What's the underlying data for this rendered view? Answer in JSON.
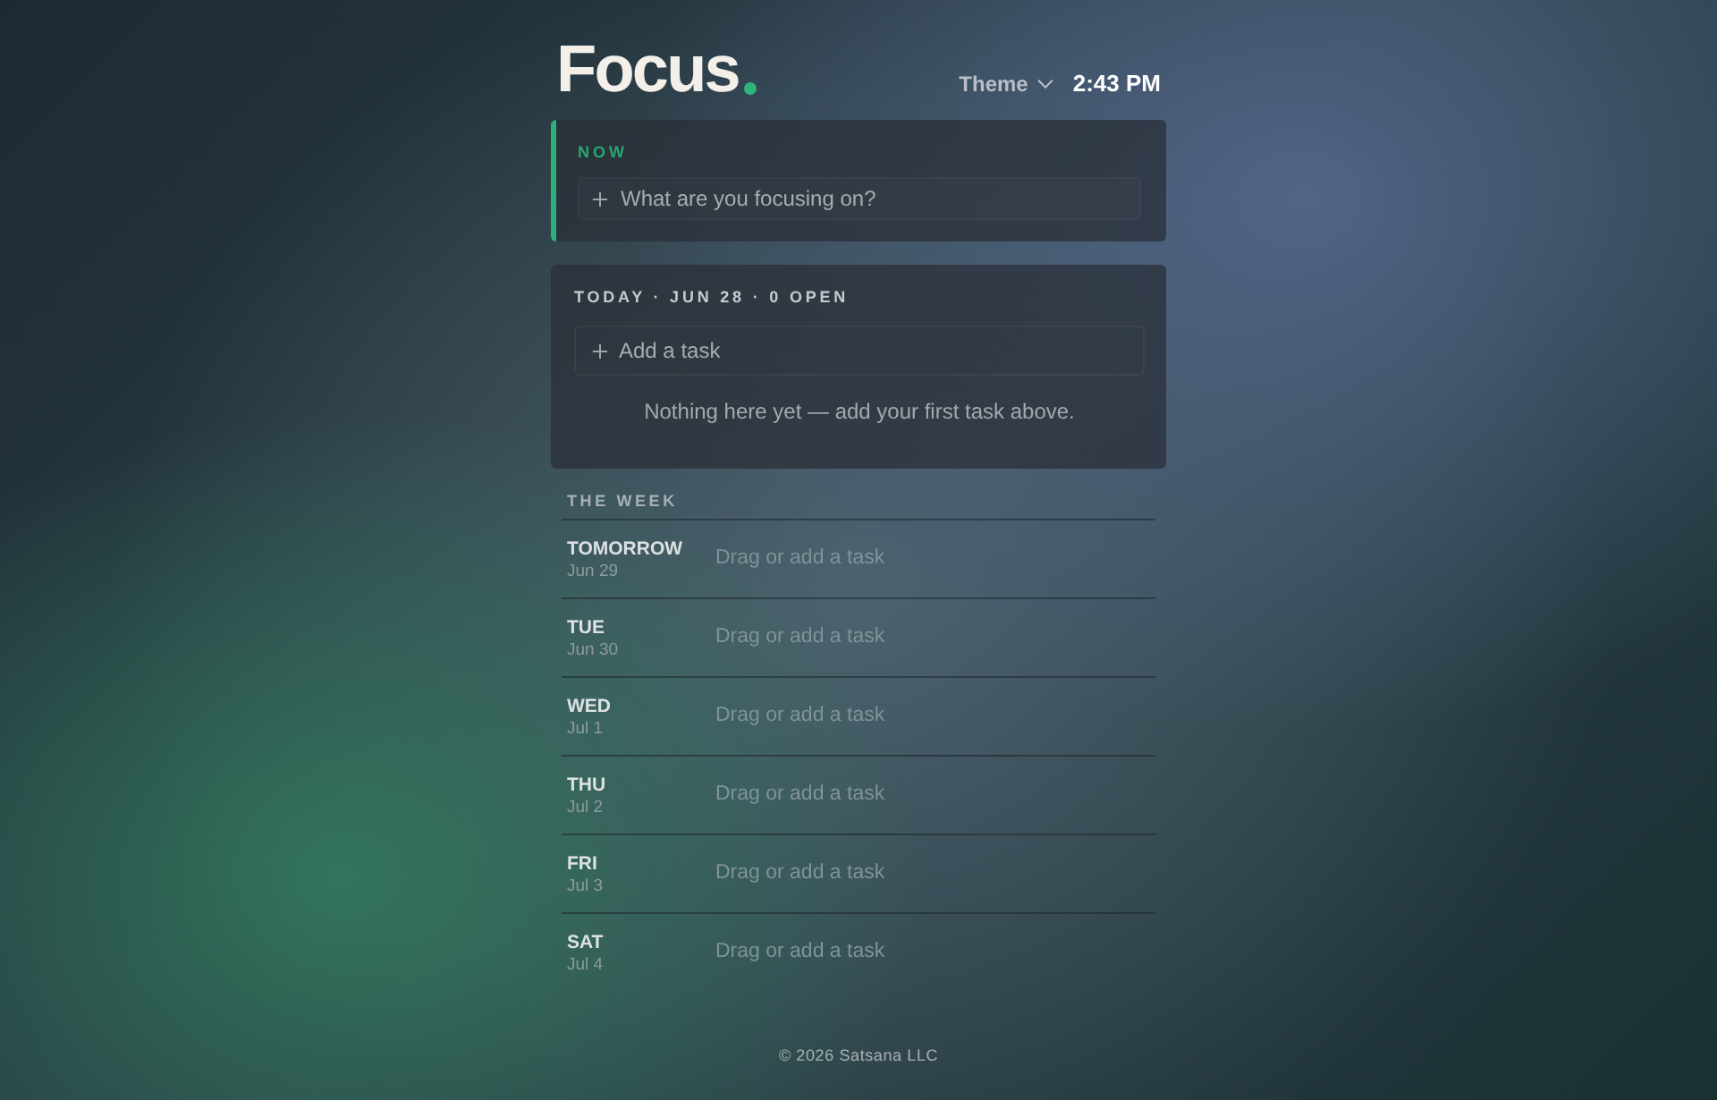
{
  "header": {
    "logo": "Focus",
    "theme_menu": {
      "label": "Theme"
    },
    "time": "2:43 PM"
  },
  "now": {
    "label": "NOW",
    "input": {
      "placeholder": "What are you focusing on?"
    }
  },
  "today": {
    "heading": "TODAY · JUN 28 · 0 OPEN",
    "add_task": {
      "placeholder": "Add a task"
    },
    "empty_message": "Nothing here yet — add your first task above."
  },
  "week": {
    "title": "THE WEEK",
    "days": [
      {
        "name": "TOMORROW",
        "date": "Jun 29",
        "placeholder": "Drag or add a task"
      },
      {
        "name": "TUE",
        "date": "Jun 30",
        "placeholder": "Drag or add a task"
      },
      {
        "name": "WED",
        "date": "Jul 1",
        "placeholder": "Drag or add a task"
      },
      {
        "name": "THU",
        "date": "Jul 2",
        "placeholder": "Drag or add a task"
      },
      {
        "name": "FRI",
        "date": "Jul 3",
        "placeholder": "Drag or add a task"
      },
      {
        "name": "SAT",
        "date": "Jul 4",
        "placeholder": "Drag or add a task"
      }
    ]
  },
  "footer": "© 2026 Satsana LLC"
}
